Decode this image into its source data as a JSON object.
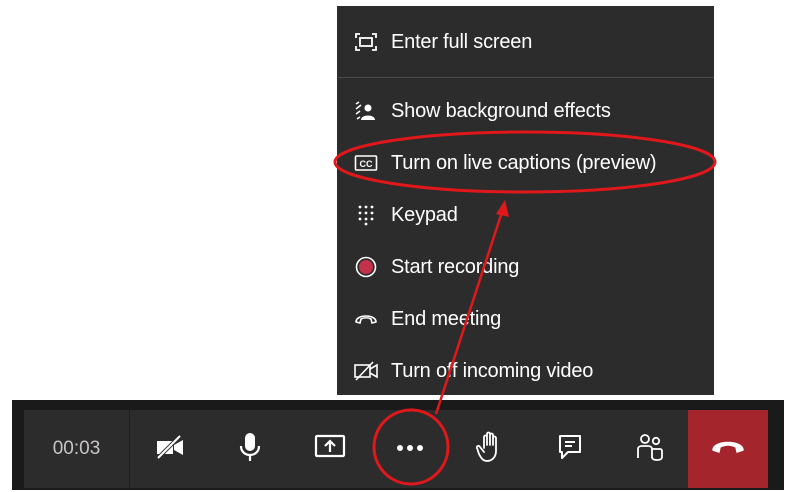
{
  "menu": {
    "items": [
      {
        "label": "Enter full screen",
        "icon": "fullscreen-icon"
      },
      {
        "label": "Show background effects",
        "icon": "background-effects-icon"
      },
      {
        "label": "Turn on live captions (preview)",
        "icon": "closed-captions-icon"
      },
      {
        "label": "Keypad",
        "icon": "keypad-icon"
      },
      {
        "label": "Start recording",
        "icon": "record-icon"
      },
      {
        "label": "End meeting",
        "icon": "end-meeting-icon"
      },
      {
        "label": "Turn off incoming video",
        "icon": "video-off-icon"
      }
    ]
  },
  "toolbar": {
    "timer": "00:03",
    "buttons": [
      "camera-off-icon",
      "microphone-icon",
      "share-screen-icon",
      "more-actions-icon",
      "raise-hand-icon",
      "chat-icon",
      "participants-icon",
      "hang-up-icon"
    ]
  },
  "colors": {
    "menu_bg": "#2d2c2c",
    "toolbar_bg": "#2d2c2c",
    "hangup": "#a4262c",
    "record_dot": "#c4314b",
    "annotation": "#e0181b"
  }
}
